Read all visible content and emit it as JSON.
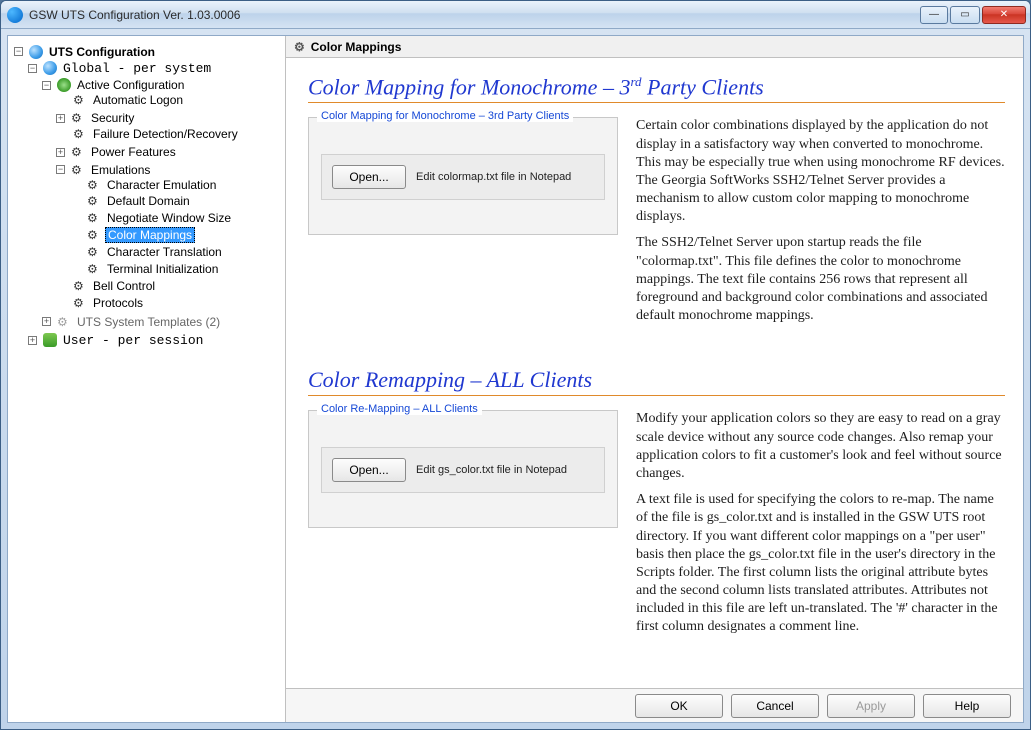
{
  "window": {
    "title": "GSW UTS Configuration      Ver. 1.03.0006"
  },
  "tree": {
    "root": "UTS Configuration",
    "global": "Global  - per system",
    "active_config": "Active Configuration",
    "automatic_logon": "Automatic Logon",
    "security": "Security",
    "failure": "Failure Detection/Recovery",
    "power": "Power Features",
    "emulations": "Emulations",
    "char_emulation": "Character Emulation",
    "default_domain": "Default Domain",
    "negotiate": "Negotiate Window Size",
    "color_mappings": "Color Mappings",
    "char_translation": "Character Translation",
    "terminal_init": "Terminal Initialization",
    "bell": "Bell Control",
    "protocols": "Protocols",
    "templates": "UTS System Templates (2)",
    "user": "User    - per session"
  },
  "content": {
    "header": "Color Mappings",
    "section1": {
      "title_prefix": "Color Mapping for Monochrome – 3",
      "title_sup": "rd",
      "title_suffix": " Party Clients",
      "legend": "Color Mapping for Monochrome – 3rd Party Clients",
      "open": "Open...",
      "hint": "Edit colormap.txt file in Notepad",
      "p1": "Certain color combinations displayed by the application do not display in a satisfactory way when converted to monochrome. This may be especially true when using monochrome RF devices. The Georgia SoftWorks SSH2/Telnet Server provides a mechanism to allow custom color mapping to monochrome displays.",
      "p2": "The SSH2/Telnet Server upon startup reads the file \"colormap.txt\". This file defines the color to monochrome mappings. The text file contains 256 rows that represent all foreground and background color combinations and associated default monochrome mappings."
    },
    "section2": {
      "title": "Color Remapping – ALL Clients",
      "legend": "Color Re-Mapping – ALL Clients",
      "open": "Open...",
      "hint": "Edit gs_color.txt file in Notepad",
      "p1": "Modify your application colors so they are easy to read on a gray scale device without any source code changes. Also remap your application colors to fit a customer's look and feel without source changes.",
      "p2": "A text file is used for specifying the colors to re-map. The name of the file is gs_color.txt and is installed in the GSW UTS root directory. If you want different color mappings on a \"per user\" basis then place the gs_color.txt file in the user's directory in the Scripts folder. The first column lists the original attribute bytes and the second column lists translated attributes. Attributes not included in this file are left un-translated. The '#' character in the first column designates a comment line."
    }
  },
  "footer": {
    "ok": "OK",
    "cancel": "Cancel",
    "apply": "Apply",
    "help": "Help"
  }
}
